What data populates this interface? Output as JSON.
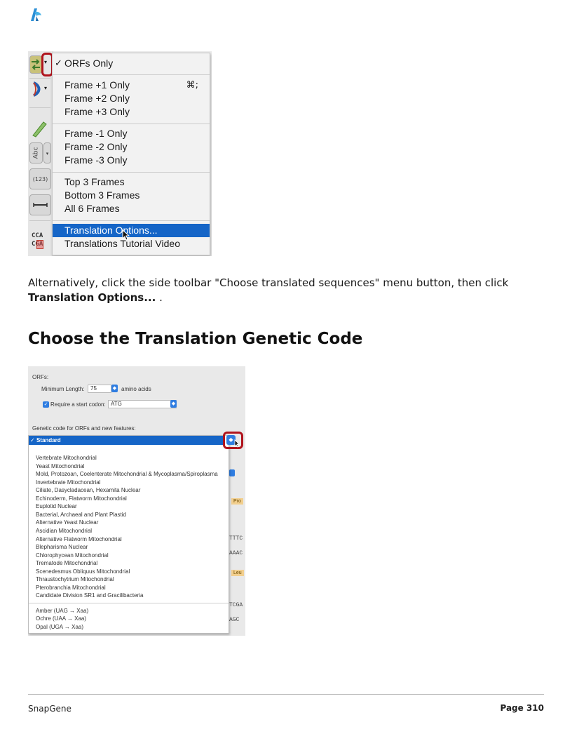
{
  "menu": {
    "items": [
      {
        "label": "ORFs Only",
        "checked": true
      },
      {
        "label": "Frame +1 Only",
        "shortcut": "⌘;"
      },
      {
        "label": "Frame +2 Only"
      },
      {
        "label": "Frame +3 Only"
      },
      {
        "label": "Frame -1 Only"
      },
      {
        "label": "Frame -2 Only"
      },
      {
        "label": "Frame -3 Only"
      },
      {
        "label": "Top 3 Frames"
      },
      {
        "label": "Bottom 3 Frames"
      },
      {
        "label": "All 6 Frames"
      },
      {
        "label": "Translation Options...",
        "highlighted": true
      },
      {
        "label": "Translations Tutorial Video"
      }
    ],
    "checkmark": "✓",
    "highlight_color": "#1565c7"
  },
  "toolbar": {
    "abc_label": "Abc",
    "num_label": "(123)",
    "seq_top": "CCA",
    "seq_bottom": "CGA"
  },
  "instructions": {
    "text": "Alternatively, click the side toolbar \"Choose translated sequences\" menu button, then click ",
    "bold": "Translation Options...",
    "tail": " ."
  },
  "heading": "Choose the Translation Genetic Code",
  "orf_panel": {
    "section_label": "ORFs:",
    "min_length_label": "Minimum Length:",
    "min_length_value": "75",
    "min_length_unit": "amino acids",
    "require_start_label": "Require a start codon:",
    "start_codon_value": "ATG",
    "genetic_code_label": "Genetic code for ORFs and new features:"
  },
  "genetic_code": {
    "selected": "Standard",
    "options": [
      "Vertebrate Mitochondrial",
      "Yeast Mitochondrial",
      "Mold, Protozoan, Coelenterate Mitochondrial & Mycoplasma/Spiroplasma",
      "Invertebrate Mitochondrial",
      "Ciliate, Dasycladacean, Hexamita Nuclear",
      "Echinoderm, Flatworm Mitochondrial",
      "Euplotid Nuclear",
      "Bacterial, Archaeal and Plant Plastid",
      "Alternative Yeast Nuclear",
      "Ascidian Mitochondrial",
      "Alternative Flatworm Mitochondrial",
      "Blepharisma Nuclear",
      "Chlorophycean Mitochondrial",
      "Trematode Mitochondrial",
      "Scenedesmus Obliquus Mitochondrial",
      "Thraustochytrium Mitochondrial",
      "Pterobranchia Mitochondrial",
      "Candidate Division SR1 and Gracilibacteria"
    ],
    "stop_options": [
      "Amber (UAG → Xaa)",
      "Ochre (UAA → Xaa)",
      "Opal (UGA → Xaa)"
    ]
  },
  "background_seq": {
    "tag1": "Pro",
    "tag2": "Leu",
    "line1": "TTTC",
    "line2": "AAAC",
    "line3": "TCGA",
    "line4": "AGC"
  },
  "footer": {
    "left": "SnapGene",
    "right": "Page 310"
  },
  "colors": {
    "accent_red": "#b0141d",
    "select_blue": "#1565c7"
  }
}
